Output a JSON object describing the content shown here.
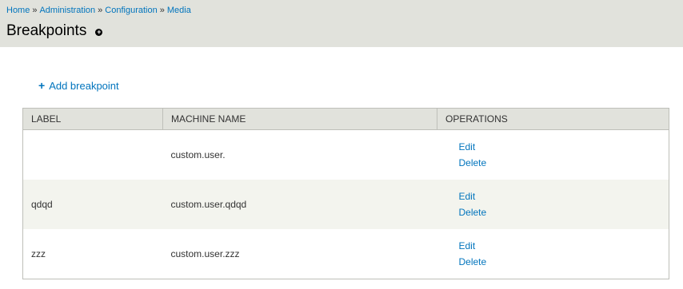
{
  "breadcrumb": {
    "items": [
      "Home",
      "Administration",
      "Configuration",
      "Media"
    ],
    "separator": "»"
  },
  "page": {
    "title": "Breakpoints",
    "shortcut_icon": "add-shortcut-icon"
  },
  "actions": {
    "add_label": "Add breakpoint",
    "add_icon": "plus-icon"
  },
  "table": {
    "headers": [
      "LABEL",
      "MACHINE NAME",
      "OPERATIONS"
    ],
    "rows": [
      {
        "label": "",
        "machine_name": "custom.user.",
        "ops": [
          "Edit",
          "Delete"
        ]
      },
      {
        "label": "qdqd",
        "machine_name": "custom.user.qdqd",
        "ops": [
          "Edit",
          "Delete"
        ]
      },
      {
        "label": "zzz",
        "machine_name": "custom.user.zzz",
        "ops": [
          "Edit",
          "Delete"
        ]
      }
    ]
  },
  "colors": {
    "link": "#0074bd",
    "header_bg": "#e1e2dc",
    "row_stripe": "#f3f4ee"
  }
}
